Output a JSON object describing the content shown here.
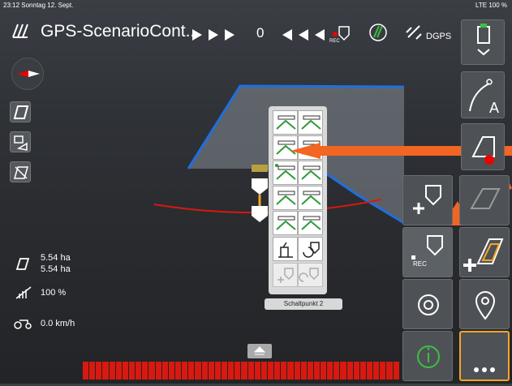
{
  "status_bar": {
    "time": "23:12",
    "date": "Sonntag 12. Sept.",
    "signal": "LTE 100 %"
  },
  "header": {
    "title": "GPS-ScenarioCont...",
    "counter": "0",
    "gps_mode": "DGPS",
    "rec_label": "REC"
  },
  "stats": {
    "area_worked": "5.54 ha",
    "area_total": "5.54 ha",
    "coverage": "100 %",
    "speed": "0.0 km/h"
  },
  "section_panel": {
    "tooltip": "Schaltpunkt 2",
    "section_count": 5
  },
  "right_panel": {
    "rec_label": "REC"
  },
  "icons": [
    "logo-icon",
    "forward-arrows-icon",
    "backward-arrows-icon",
    "rec-marker-icon",
    "field-icon",
    "satellite-icon",
    "tractor-icon",
    "chevron-down-icon",
    "guidance-a-icon",
    "headland-icon",
    "compass-icon",
    "area-icon",
    "camera-swap-icon",
    "map-edit-icon",
    "add-marker-icon",
    "rec-marker-button-icon",
    "add-boundary-icon",
    "settings-icon",
    "location-pin-icon",
    "info-icon",
    "more-icon"
  ],
  "colors": {
    "accent_orange": "#f26522",
    "field_border": "#1f6fe0",
    "guidance_red": "#d8190f",
    "section_green": "#2e9b3a",
    "info_green": "#3fbf3f"
  },
  "section_bar": {
    "segments": 48
  }
}
